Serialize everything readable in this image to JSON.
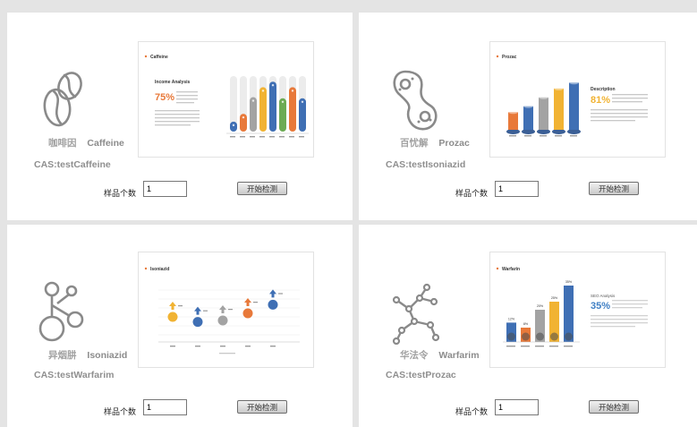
{
  "panels": [
    {
      "name_cn": "咖啡因",
      "name_en": "Caffeine",
      "cas": "CAS:testCaffeine",
      "count_label": "样品个数",
      "count_value": "1",
      "start_label": "开始检测",
      "icon": "coffee-beans-icon",
      "thumb": {
        "title": "Caffeine",
        "subtitle": "Income Analysis",
        "percent": "75%",
        "chart_data": {
          "type": "bar",
          "categories": [
            "",
            "",
            "",
            "",
            "",
            "",
            "",
            ""
          ],
          "values": [
            18,
            32,
            62,
            80,
            90,
            60,
            80,
            60
          ],
          "ylim": [
            0,
            100
          ]
        }
      }
    },
    {
      "name_cn": "百忧解",
      "name_en": "Prozac",
      "cas": "CAS:testIsoniazid",
      "count_label": "样品个数",
      "count_value": "1",
      "start_label": "开始检测",
      "icon": "pill-cells-icon",
      "thumb": {
        "title": "Prozac",
        "subtitle": "Description",
        "percent": "81%",
        "chart_data": {
          "type": "bar",
          "categories": [
            "",
            "",
            "",
            "",
            ""
          ],
          "values": [
            30,
            40,
            55,
            70,
            80
          ],
          "ylim": [
            0,
            100
          ]
        }
      }
    },
    {
      "name_cn": "异烟肼",
      "name_en": "Isoniazid",
      "cas": "CAS:testWarfarim",
      "count_label": "样品个数",
      "count_value": "1",
      "start_label": "开始检测",
      "icon": "molecule-rings-icon",
      "thumb": {
        "title": "Isoniazid",
        "chart_data": {
          "type": "scatter",
          "values": [
            35,
            28,
            30,
            40,
            52
          ],
          "ylim": [
            0,
            100
          ]
        }
      }
    },
    {
      "name_cn": "华法令",
      "name_en": "Warfarim",
      "cas": "CAS:testProzac",
      "count_label": "样品个数",
      "count_value": "1",
      "start_label": "开始检测",
      "icon": "molecule-network-icon",
      "thumb": {
        "title": "Warfarin",
        "subtitle": "SEO Analysis",
        "percent": "35%",
        "chart_data": {
          "type": "bar",
          "categories": [
            "",
            "",
            "",
            "",
            ""
          ],
          "values": [
            12,
            8,
            20,
            25,
            35
          ],
          "data_labels": [
            "12%",
            "8%",
            "20%",
            "25%",
            "35%"
          ],
          "ylim": [
            0,
            40
          ]
        }
      }
    }
  ],
  "colors": {
    "blue": "#3f6fb4",
    "orange": "#e8793a",
    "gray": "#a3a3a3",
    "yellow": "#f1b333",
    "green": "#6cab54",
    "accent_orange": "#e8793a",
    "accent_yellow": "#f1b333",
    "accent_blue": "#3f7fc4"
  }
}
